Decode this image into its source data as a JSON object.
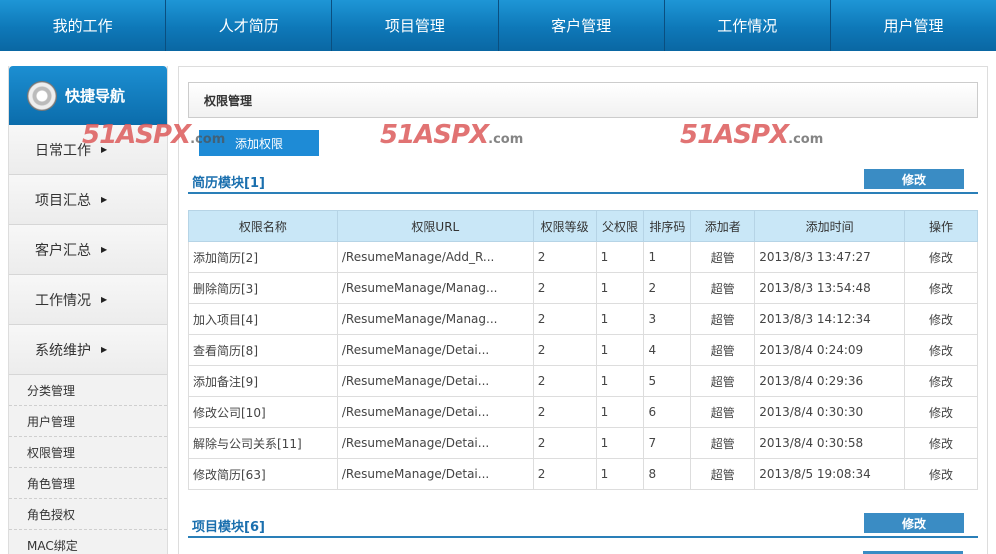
{
  "topnav": [
    "我的工作",
    "人才简历",
    "项目管理",
    "客户管理",
    "工作情况",
    "用户管理"
  ],
  "sidebar": {
    "title": "快捷导航",
    "main_items": [
      "日常工作",
      "项目汇总",
      "客户汇总",
      "工作情况",
      "系统维护"
    ],
    "sub_items": [
      "分类管理",
      "用户管理",
      "权限管理",
      "角色管理",
      "角色授权",
      "MAC绑定"
    ]
  },
  "content": {
    "page_title": "权限管理",
    "add_button": "添加权限",
    "watermark_text": "51ASPX",
    "watermark_domain": ".com",
    "sections": [
      {
        "title": "简历模块[1]",
        "edit_label": "修改"
      },
      {
        "title": "项目模块[6]",
        "edit_label": "修改"
      }
    ],
    "table": {
      "headers": [
        "权限名称",
        "权限URL",
        "权限等级",
        "父权限",
        "排序码",
        "添加者",
        "添加时间",
        "操作"
      ],
      "rows": [
        [
          "添加简历[2]",
          "/ResumeManage/Add_R...",
          "2",
          "1",
          "1",
          "超管",
          "2013/8/3 13:47:27",
          "修改"
        ],
        [
          "删除简历[3]",
          "/ResumeManage/Manag...",
          "2",
          "1",
          "2",
          "超管",
          "2013/8/3 13:54:48",
          "修改"
        ],
        [
          "加入项目[4]",
          "/ResumeManage/Manag...",
          "2",
          "1",
          "3",
          "超管",
          "2013/8/3 14:12:34",
          "修改"
        ],
        [
          "查看简历[8]",
          "/ResumeManage/Detai...",
          "2",
          "1",
          "4",
          "超管",
          "2013/8/4 0:24:09",
          "修改"
        ],
        [
          "添加备注[9]",
          "/ResumeManage/Detai...",
          "2",
          "1",
          "5",
          "超管",
          "2013/8/4 0:29:36",
          "修改"
        ],
        [
          "修改公司[10]",
          "/ResumeManage/Detai...",
          "2",
          "1",
          "6",
          "超管",
          "2013/8/4 0:30:30",
          "修改"
        ],
        [
          "解除与公司关系[11]",
          "/ResumeManage/Detai...",
          "2",
          "1",
          "7",
          "超管",
          "2013/8/4 0:30:58",
          "修改"
        ],
        [
          "修改简历[63]",
          "/ResumeManage/Detai...",
          "2",
          "1",
          "8",
          "超管",
          "2013/8/5 19:08:34",
          "修改"
        ]
      ]
    }
  }
}
